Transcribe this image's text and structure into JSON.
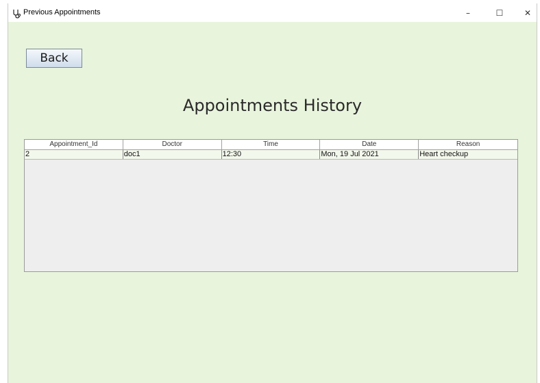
{
  "window": {
    "title": "Previous Appointments",
    "controls": {
      "minimize": "–",
      "maximize": "☐",
      "close": "✕"
    }
  },
  "toolbar": {
    "back_label": "Back"
  },
  "page": {
    "heading": "Appointments History"
  },
  "table": {
    "columns": [
      "Appointment_Id",
      "Doctor",
      "Time",
      "Date",
      "Reason"
    ],
    "rows": [
      [
        "2",
        "doc1",
        "12:30",
        "Mon, 19 Jul 2021",
        "Heart checkup"
      ]
    ]
  },
  "colors": {
    "background": "#e8f4dc",
    "table_area": "#eeeeee",
    "button_gradient_top": "#f4f8fc",
    "button_gradient_bottom": "#cfdceb"
  },
  "icons": {
    "app": "stethoscope-icon"
  }
}
